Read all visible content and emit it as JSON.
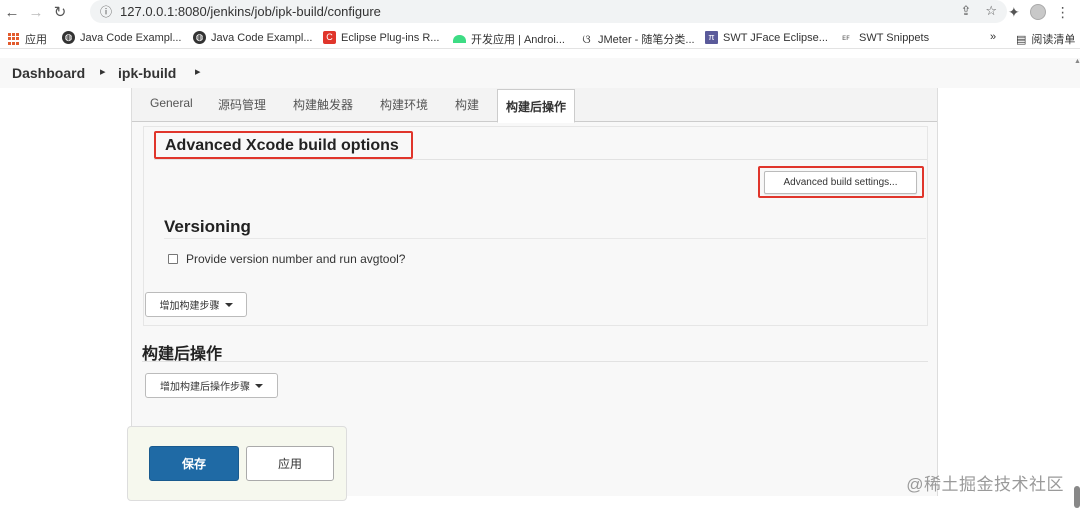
{
  "browser": {
    "url": "127.0.0.1:8080/jenkins/job/ipk-build/configure",
    "bookmarks": [
      {
        "label": "应用",
        "color": "#e25b2d"
      },
      {
        "label": "Java Code Exampl...",
        "color": "#333333"
      },
      {
        "label": "Java Code Exampl...",
        "color": "#333333"
      },
      {
        "label": "Eclipse Plug-ins R...",
        "color": "#e0352b"
      },
      {
        "label": "开发应用 | Androi...",
        "color": "#3ddc84"
      },
      {
        "label": "JMeter - 随笔分类...",
        "color": "#444444"
      },
      {
        "label": "SWT JFace Eclipse...",
        "color": "#5a5a9a"
      },
      {
        "label": "SWT Snippets",
        "color": "#666666"
      }
    ],
    "more_label": "»",
    "reading_list": "阅读清单"
  },
  "breadcrumb": {
    "dashboard": "Dashboard",
    "job": "ipk-build",
    "arrow": "▸"
  },
  "tabs": [
    "General",
    "源码管理",
    "构建触发器",
    "构建环境",
    "构建",
    "构建后操作"
  ],
  "xcode": {
    "title": "Advanced Xcode build options",
    "advanced_button": "Advanced build settings..."
  },
  "versioning": {
    "heading": "Versioning",
    "checkbox_label": "Provide version number and run avgtool?"
  },
  "add_build_step": "增加构建步骤",
  "post_build": {
    "heading": "构建后操作",
    "add_step": "增加构建后操作步骤"
  },
  "actions": {
    "save": "保存",
    "apply": "应用"
  },
  "watermark": "@稀土掘金技术社区"
}
